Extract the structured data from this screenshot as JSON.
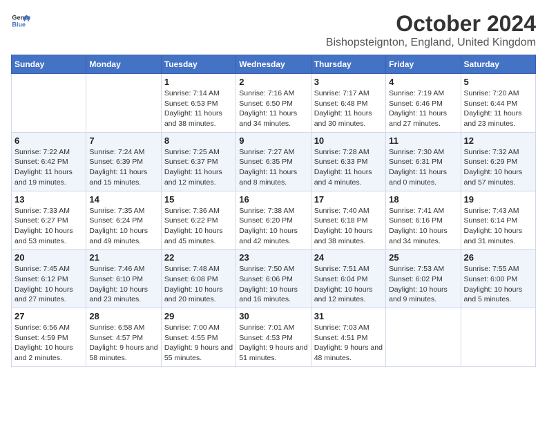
{
  "header": {
    "logo_line1": "General",
    "logo_line2": "Blue",
    "month": "October 2024",
    "location": "Bishopsteignton, England, United Kingdom"
  },
  "days_of_week": [
    "Sunday",
    "Monday",
    "Tuesday",
    "Wednesday",
    "Thursday",
    "Friday",
    "Saturday"
  ],
  "weeks": [
    [
      {
        "day": "",
        "info": ""
      },
      {
        "day": "",
        "info": ""
      },
      {
        "day": "1",
        "info": "Sunrise: 7:14 AM\nSunset: 6:53 PM\nDaylight: 11 hours and 38 minutes."
      },
      {
        "day": "2",
        "info": "Sunrise: 7:16 AM\nSunset: 6:50 PM\nDaylight: 11 hours and 34 minutes."
      },
      {
        "day": "3",
        "info": "Sunrise: 7:17 AM\nSunset: 6:48 PM\nDaylight: 11 hours and 30 minutes."
      },
      {
        "day": "4",
        "info": "Sunrise: 7:19 AM\nSunset: 6:46 PM\nDaylight: 11 hours and 27 minutes."
      },
      {
        "day": "5",
        "info": "Sunrise: 7:20 AM\nSunset: 6:44 PM\nDaylight: 11 hours and 23 minutes."
      }
    ],
    [
      {
        "day": "6",
        "info": "Sunrise: 7:22 AM\nSunset: 6:42 PM\nDaylight: 11 hours and 19 minutes."
      },
      {
        "day": "7",
        "info": "Sunrise: 7:24 AM\nSunset: 6:39 PM\nDaylight: 11 hours and 15 minutes."
      },
      {
        "day": "8",
        "info": "Sunrise: 7:25 AM\nSunset: 6:37 PM\nDaylight: 11 hours and 12 minutes."
      },
      {
        "day": "9",
        "info": "Sunrise: 7:27 AM\nSunset: 6:35 PM\nDaylight: 11 hours and 8 minutes."
      },
      {
        "day": "10",
        "info": "Sunrise: 7:28 AM\nSunset: 6:33 PM\nDaylight: 11 hours and 4 minutes."
      },
      {
        "day": "11",
        "info": "Sunrise: 7:30 AM\nSunset: 6:31 PM\nDaylight: 11 hours and 0 minutes."
      },
      {
        "day": "12",
        "info": "Sunrise: 7:32 AM\nSunset: 6:29 PM\nDaylight: 10 hours and 57 minutes."
      }
    ],
    [
      {
        "day": "13",
        "info": "Sunrise: 7:33 AM\nSunset: 6:27 PM\nDaylight: 10 hours and 53 minutes."
      },
      {
        "day": "14",
        "info": "Sunrise: 7:35 AM\nSunset: 6:24 PM\nDaylight: 10 hours and 49 minutes."
      },
      {
        "day": "15",
        "info": "Sunrise: 7:36 AM\nSunset: 6:22 PM\nDaylight: 10 hours and 45 minutes."
      },
      {
        "day": "16",
        "info": "Sunrise: 7:38 AM\nSunset: 6:20 PM\nDaylight: 10 hours and 42 minutes."
      },
      {
        "day": "17",
        "info": "Sunrise: 7:40 AM\nSunset: 6:18 PM\nDaylight: 10 hours and 38 minutes."
      },
      {
        "day": "18",
        "info": "Sunrise: 7:41 AM\nSunset: 6:16 PM\nDaylight: 10 hours and 34 minutes."
      },
      {
        "day": "19",
        "info": "Sunrise: 7:43 AM\nSunset: 6:14 PM\nDaylight: 10 hours and 31 minutes."
      }
    ],
    [
      {
        "day": "20",
        "info": "Sunrise: 7:45 AM\nSunset: 6:12 PM\nDaylight: 10 hours and 27 minutes."
      },
      {
        "day": "21",
        "info": "Sunrise: 7:46 AM\nSunset: 6:10 PM\nDaylight: 10 hours and 23 minutes."
      },
      {
        "day": "22",
        "info": "Sunrise: 7:48 AM\nSunset: 6:08 PM\nDaylight: 10 hours and 20 minutes."
      },
      {
        "day": "23",
        "info": "Sunrise: 7:50 AM\nSunset: 6:06 PM\nDaylight: 10 hours and 16 minutes."
      },
      {
        "day": "24",
        "info": "Sunrise: 7:51 AM\nSunset: 6:04 PM\nDaylight: 10 hours and 12 minutes."
      },
      {
        "day": "25",
        "info": "Sunrise: 7:53 AM\nSunset: 6:02 PM\nDaylight: 10 hours and 9 minutes."
      },
      {
        "day": "26",
        "info": "Sunrise: 7:55 AM\nSunset: 6:00 PM\nDaylight: 10 hours and 5 minutes."
      }
    ],
    [
      {
        "day": "27",
        "info": "Sunrise: 6:56 AM\nSunset: 4:59 PM\nDaylight: 10 hours and 2 minutes."
      },
      {
        "day": "28",
        "info": "Sunrise: 6:58 AM\nSunset: 4:57 PM\nDaylight: 9 hours and 58 minutes."
      },
      {
        "day": "29",
        "info": "Sunrise: 7:00 AM\nSunset: 4:55 PM\nDaylight: 9 hours and 55 minutes."
      },
      {
        "day": "30",
        "info": "Sunrise: 7:01 AM\nSunset: 4:53 PM\nDaylight: 9 hours and 51 minutes."
      },
      {
        "day": "31",
        "info": "Sunrise: 7:03 AM\nSunset: 4:51 PM\nDaylight: 9 hours and 48 minutes."
      },
      {
        "day": "",
        "info": ""
      },
      {
        "day": "",
        "info": ""
      }
    ]
  ]
}
